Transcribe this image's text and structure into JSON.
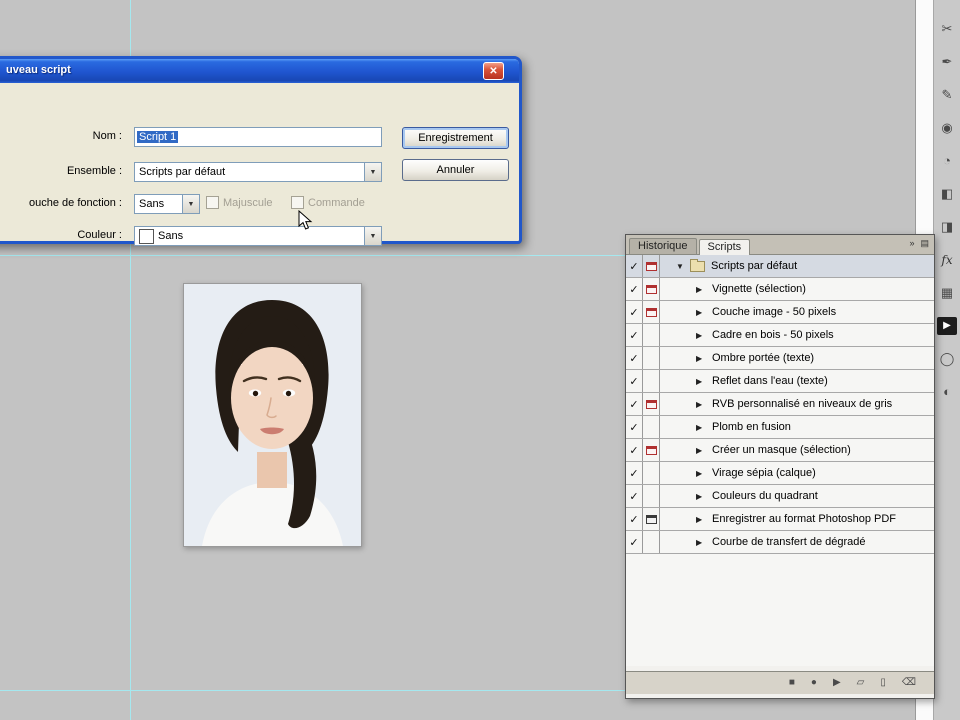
{
  "workspace": {
    "bg_color": "#c3c3c3",
    "guide_color": "#a5e8ef",
    "selection_color": "#316ac5"
  },
  "icons": {
    "close": "✕",
    "dropdown_arrow": "▼",
    "checkmark": "✓",
    "expand_collapsed": "▶",
    "expand_expanded": "▼",
    "panel_collapse": "»",
    "panel_menu": "▤"
  },
  "dialog": {
    "title": "uveau script",
    "name_label": "Nom :",
    "name_value": "Script 1",
    "record_label": "Enregistrement",
    "set_label": "Ensemble :",
    "set_value": "Scripts par défaut",
    "cancel_label": "Annuler",
    "fkey_label": "ouche de fonction :",
    "fkey_value": "Sans",
    "majuscule_label": "Majuscule",
    "commande_label": "Commande",
    "color_label": "Couleur :",
    "color_value": "Sans"
  },
  "actions_panel": {
    "tabs": [
      {
        "label": "Historique",
        "active": false
      },
      {
        "label": "Scripts",
        "active": true
      }
    ],
    "rows": [
      {
        "label": "Scripts par défaut",
        "type": "set",
        "checked": true,
        "dialog": "red",
        "expanded": true,
        "selected": true
      },
      {
        "label": "Vignette (sélection)",
        "type": "action",
        "checked": true,
        "dialog": "red",
        "expanded": false,
        "selected": false
      },
      {
        "label": "Couche image - 50 pixels",
        "type": "action",
        "checked": true,
        "dialog": "red",
        "expanded": false,
        "selected": false
      },
      {
        "label": "Cadre en bois - 50 pixels",
        "type": "action",
        "checked": true,
        "dialog": "none",
        "expanded": false,
        "selected": false
      },
      {
        "label": "Ombre portée (texte)",
        "type": "action",
        "checked": true,
        "dialog": "none",
        "expanded": false,
        "selected": false
      },
      {
        "label": "Reflet dans l'eau (texte)",
        "type": "action",
        "checked": true,
        "dialog": "none",
        "expanded": false,
        "selected": false
      },
      {
        "label": "RVB personnalisé en niveaux de gris",
        "type": "action",
        "checked": true,
        "dialog": "red",
        "expanded": false,
        "selected": false
      },
      {
        "label": "Plomb en fusion",
        "type": "action",
        "checked": true,
        "dialog": "none",
        "expanded": false,
        "selected": false
      },
      {
        "label": "Créer un masque (sélection)",
        "type": "action",
        "checked": true,
        "dialog": "red",
        "expanded": false,
        "selected": false
      },
      {
        "label": "Virage sépia (calque)",
        "type": "action",
        "checked": true,
        "dialog": "none",
        "expanded": false,
        "selected": false
      },
      {
        "label": "Couleurs du quadrant",
        "type": "action",
        "checked": true,
        "dialog": "none",
        "expanded": false,
        "selected": false
      },
      {
        "label": "Enregistrer au format Photoshop PDF",
        "type": "action",
        "checked": true,
        "dialog": "dark",
        "expanded": false,
        "selected": false
      },
      {
        "label": "Courbe de transfert de dégradé",
        "type": "action",
        "checked": true,
        "dialog": "none",
        "expanded": false,
        "selected": false
      }
    ],
    "footer_buttons": [
      {
        "name": "stop-button",
        "glyph": "■"
      },
      {
        "name": "record-button",
        "glyph": "●"
      },
      {
        "name": "play-button",
        "glyph": "▶"
      },
      {
        "name": "new-set-button",
        "glyph": "▱"
      },
      {
        "name": "new-action-button",
        "glyph": "▯"
      },
      {
        "name": "delete-button",
        "glyph": "⌫"
      }
    ]
  },
  "right_toolbar": {
    "icons": [
      {
        "name": "scissors-icon",
        "glyph": "✂",
        "dark": false
      },
      {
        "name": "pen-icon",
        "glyph": "✒",
        "dark": false
      },
      {
        "name": "brush-icon",
        "glyph": "✎",
        "dark": false
      },
      {
        "name": "stamp-icon",
        "glyph": "◉",
        "dark": false
      },
      {
        "name": "history-brush-icon",
        "glyph": "◔",
        "dark": false
      },
      {
        "name": "eraser-icon",
        "glyph": "◧",
        "dark": false
      },
      {
        "name": "gradient-icon",
        "glyph": "◨",
        "dark": false
      },
      {
        "name": "fx-icon",
        "glyph": "fx",
        "dark": false
      },
      {
        "name": "grid-icon",
        "glyph": "▦",
        "dark": false
      },
      {
        "name": "play-panel-icon",
        "glyph": "▶",
        "dark": true
      },
      {
        "name": "shape-icon",
        "glyph": "◯",
        "dark": false
      },
      {
        "name": "mask-icon",
        "glyph": "◐",
        "dark": false
      }
    ]
  }
}
